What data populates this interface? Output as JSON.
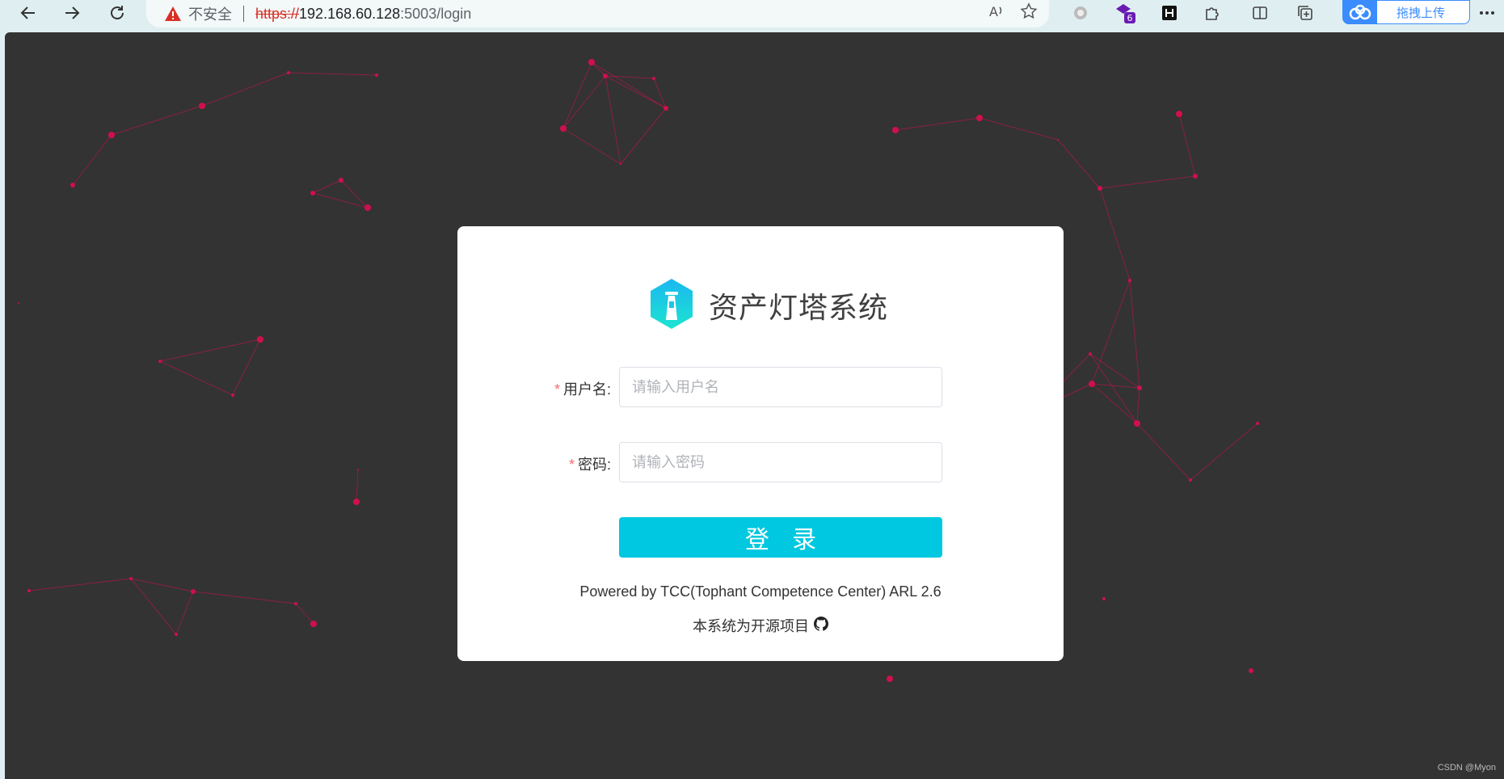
{
  "browser": {
    "insecure_label": "不安全",
    "url_scheme": "https://",
    "url_host": "192.168.60.128",
    "url_rest": ":5003/login",
    "extension_badge": "6",
    "upload_label": "拖拽上传"
  },
  "login": {
    "system_title": "资产灯塔系统",
    "username_label": "用户名:",
    "username_placeholder": "请输入用户名",
    "password_label": "密码:",
    "password_placeholder": "请输入密码",
    "required_mark": "*",
    "login_button": "登 录",
    "powered_by": "Powered by TCC(Tophant Competence Center) ARL 2.6",
    "open_source": "本系统为开源项目"
  },
  "watermark": "CSDN @Myon⁠",
  "colors": {
    "accent": "#00c8e0",
    "background": "#333333",
    "particle": "#d0104c"
  }
}
